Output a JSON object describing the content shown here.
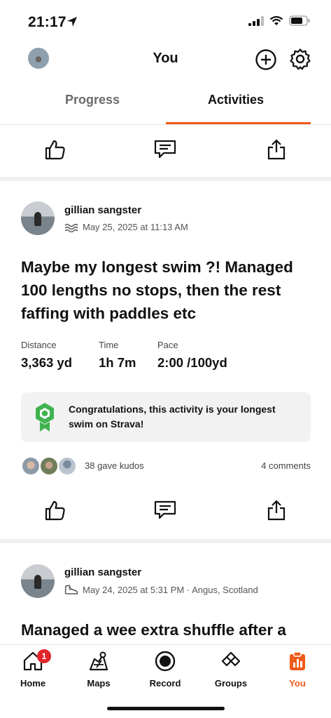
{
  "status_bar": {
    "time": "21:17"
  },
  "header": {
    "title": "You"
  },
  "tabs": [
    {
      "label": "Progress",
      "active": false
    },
    {
      "label": "Activities",
      "active": true
    }
  ],
  "activities": [
    {
      "athlete_name": "gillian sangster",
      "sport_icon": "swim-icon",
      "meta": "May 25, 2025 at 11:13 AM",
      "title": "Maybe my longest swim ?! Managed 100 lengths no stops, then the rest faffing with paddles etc",
      "stats": [
        {
          "label": "Distance",
          "value": "3,363 yd"
        },
        {
          "label": "Time",
          "value": "1h 7m"
        },
        {
          "label": "Pace",
          "value": "2:00 /100yd"
        }
      ],
      "achievement": "Congratulations, this activity is your longest swim on Strava!",
      "kudos": "38 gave kudos",
      "comments": "4 comments"
    },
    {
      "athlete_name": "gillian sangster",
      "sport_icon": "run-shoe-icon",
      "meta": "May 24, 2025 at 5:31 PM · Angus, Scotland",
      "title": "Managed a wee extra shuffle after a"
    }
  ],
  "bottom_nav": [
    {
      "label": "Home",
      "icon": "home-icon",
      "badge": "1"
    },
    {
      "label": "Maps",
      "icon": "maps-icon"
    },
    {
      "label": "Record",
      "icon": "record-icon"
    },
    {
      "label": "Groups",
      "icon": "groups-icon"
    },
    {
      "label": "You",
      "icon": "you-icon",
      "active": true
    }
  ],
  "colors": {
    "accent": "#f05a1a",
    "badge": "#e0262b",
    "achievement_green": "#3fb34f"
  }
}
